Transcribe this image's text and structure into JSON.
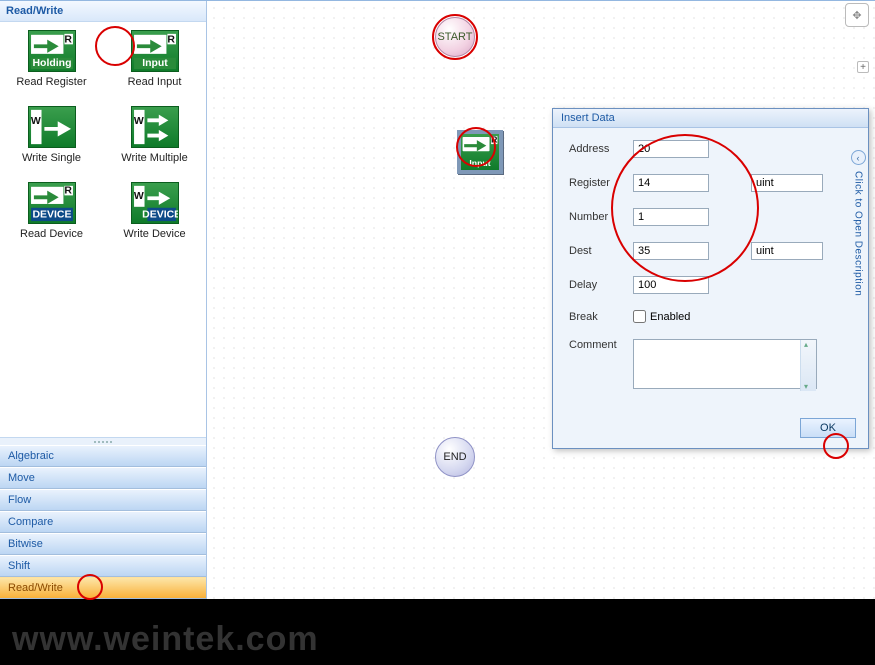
{
  "sidebar": {
    "header": "Read/Write",
    "tools": [
      {
        "label": "Read Register",
        "icon": "read-register"
      },
      {
        "label": "Read Input",
        "icon": "read-input"
      },
      {
        "label": "Write Single",
        "icon": "write-single"
      },
      {
        "label": "Write Multiple",
        "icon": "write-multiple"
      },
      {
        "label": "Read Device",
        "icon": "read-device"
      },
      {
        "label": "Write Device",
        "icon": "write-device"
      }
    ],
    "categories": [
      {
        "label": "Algebraic",
        "active": false
      },
      {
        "label": "Move",
        "active": false
      },
      {
        "label": "Flow",
        "active": false
      },
      {
        "label": "Compare",
        "active": false
      },
      {
        "label": "Bitwise",
        "active": false
      },
      {
        "label": "Shift",
        "active": false
      },
      {
        "label": "Read/Write",
        "active": true
      }
    ]
  },
  "nodes": {
    "start": "START",
    "end": "END"
  },
  "dialog": {
    "title": "Insert Data",
    "labels": {
      "address": "Address",
      "register": "Register",
      "number": "Number",
      "dest": "Dest",
      "delay": "Delay",
      "break": "Break",
      "enabled": "Enabled",
      "comment": "Comment"
    },
    "values": {
      "address": "20",
      "register": "14",
      "register_type": "uint",
      "number": "1",
      "dest": "35",
      "dest_type": "uint",
      "delay": "100",
      "break_enabled": false,
      "comment": ""
    },
    "ok": "OK",
    "side_text": "Click to Open Description"
  },
  "watermark": "www.weintek.com"
}
